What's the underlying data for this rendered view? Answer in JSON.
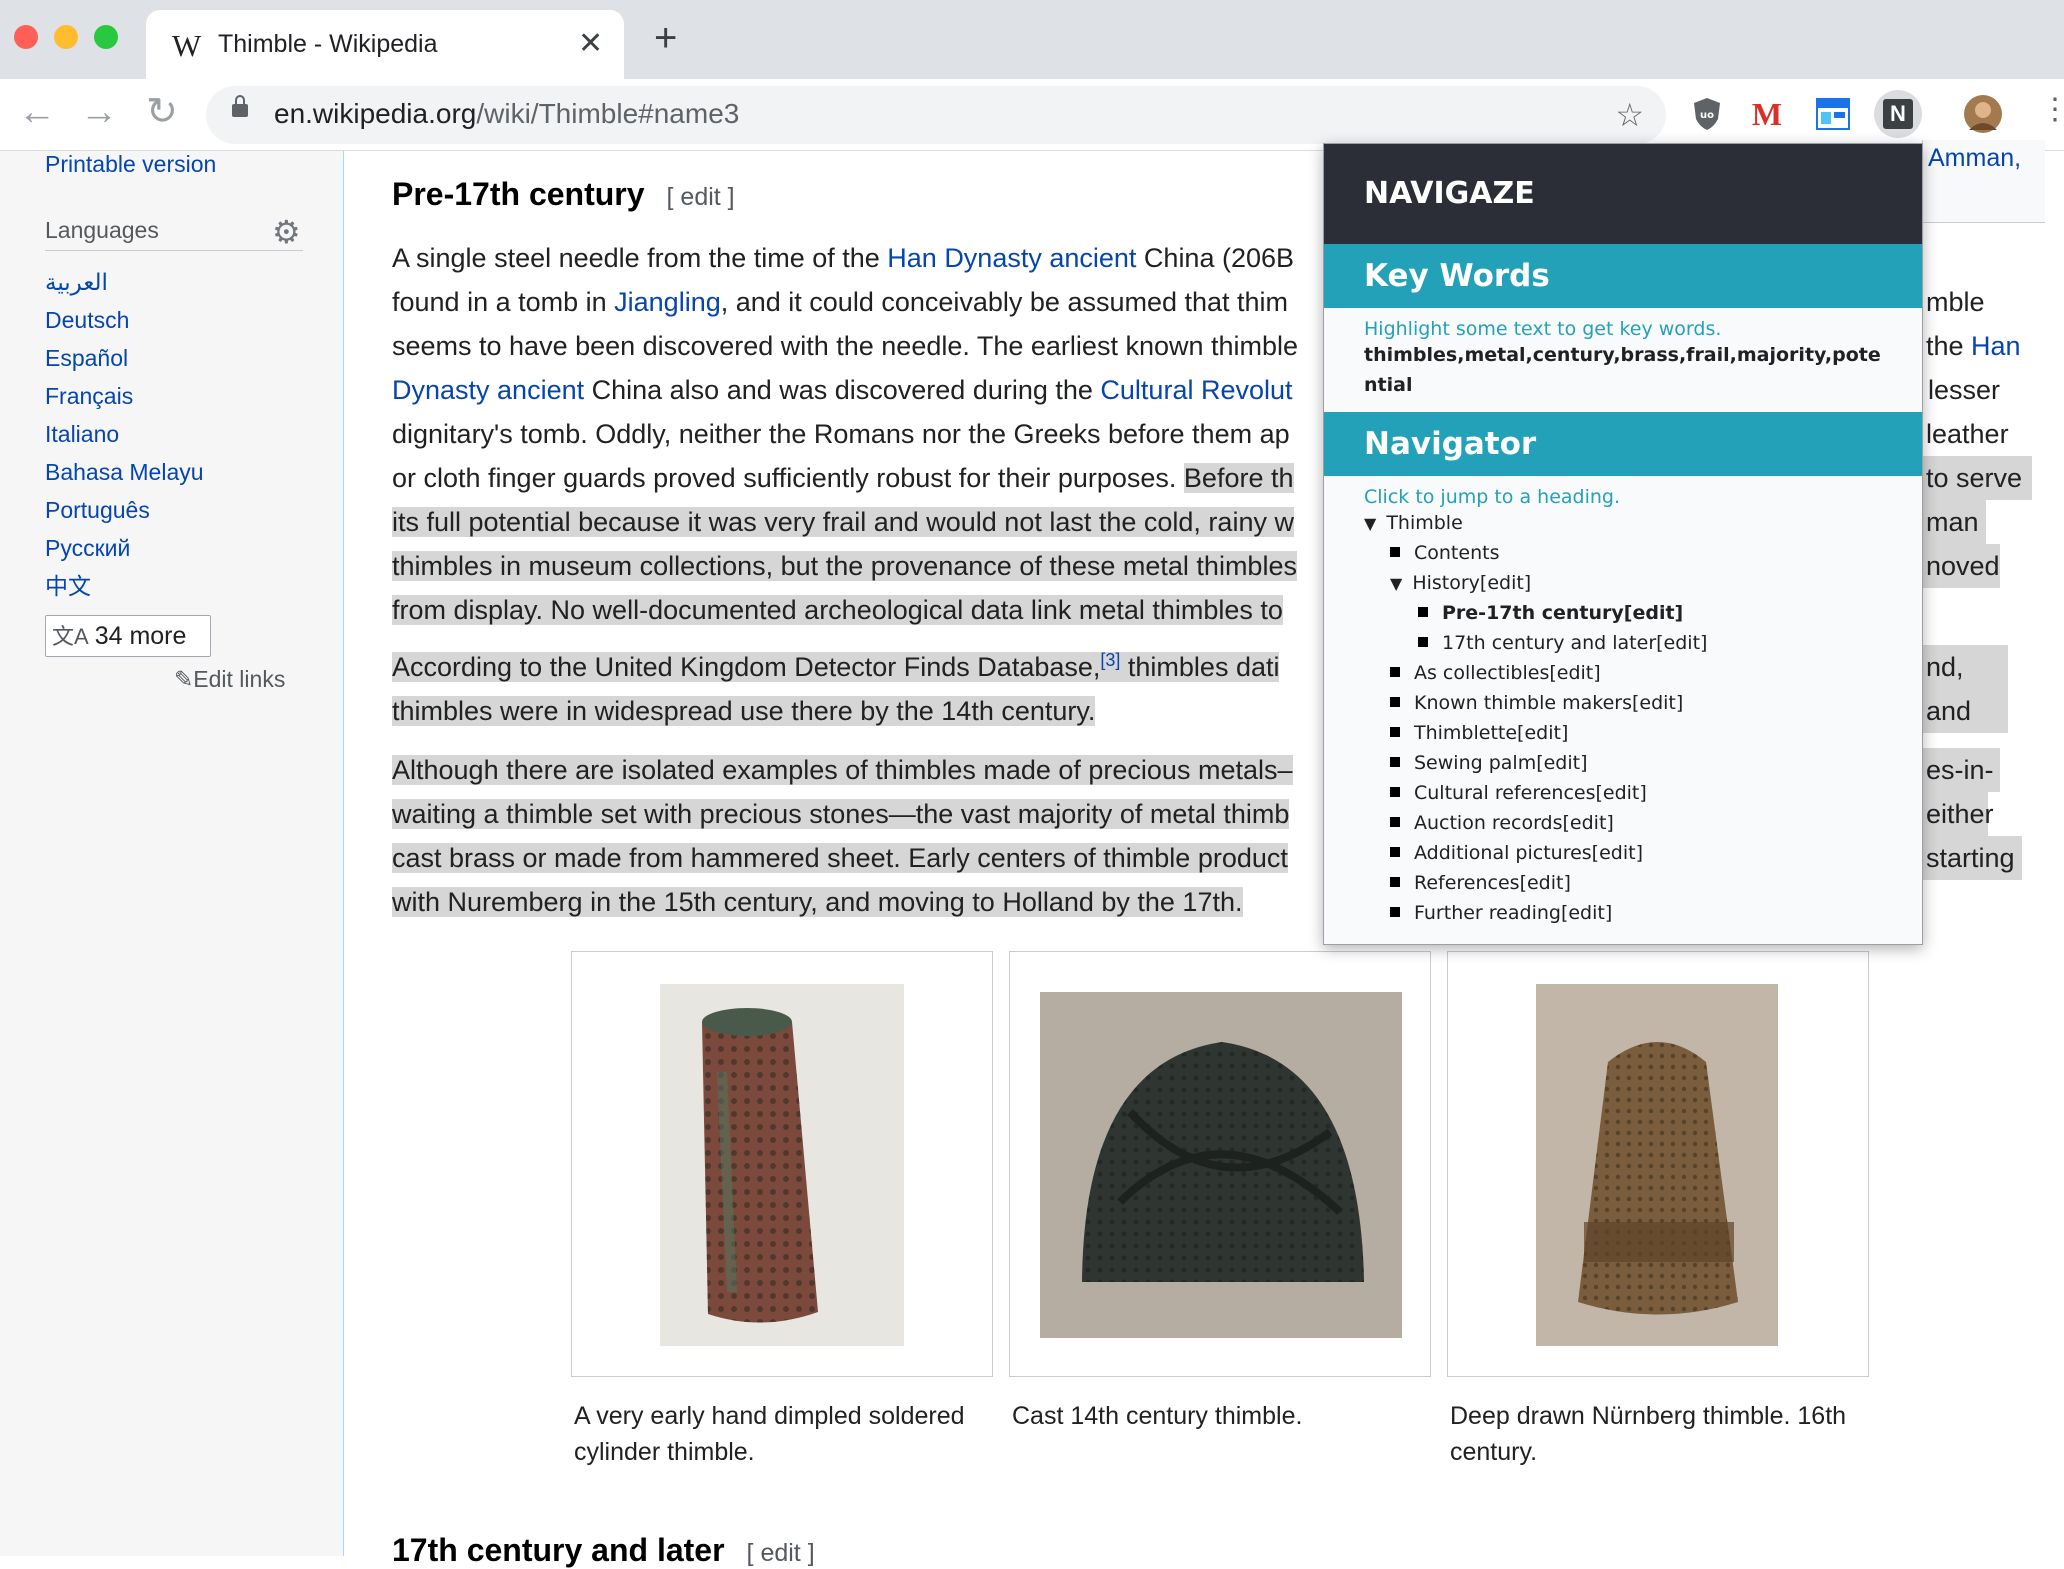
{
  "browser": {
    "tab_title": "Thimble - Wikipedia",
    "tab_icon": "W",
    "url_domain": "en.wikipedia.org",
    "url_path": "/wiki/Thimble#name3",
    "extensions": [
      "ublock-icon",
      "gmail-icon",
      "calendar-icon",
      "navigaze-icon",
      "profile-avatar"
    ],
    "ext_letters": {
      "gmail": "M",
      "navigaze": "N"
    }
  },
  "sidebar": {
    "printable": "Printable version",
    "languages_heading": "Languages",
    "languages": [
      "العربية",
      "Deutsch",
      "Español",
      "Français",
      "Italiano",
      "Bahasa Melayu",
      "Português",
      "Русский",
      "中文"
    ],
    "more_label": "34 more",
    "edit_links": "Edit links"
  },
  "article": {
    "heading1": "Pre-17th century",
    "edit_label": "[ edit ]",
    "p1": {
      "l1a": "A single steel needle from the time of the ",
      "l1link1": "Han Dynasty ancient",
      "l1b": " China (206B",
      "l2a": "found in a tomb in ",
      "l2link": "Jiangling",
      "l2b": ", and it could conceivably be assumed that thim",
      "l3": "seems to have been discovered with the needle. The earliest known thimble",
      "l4link": "Dynasty ancient",
      "l4a": " China also and was discovered during the ",
      "l4link2": "Cultural Revolut",
      "l5": "dignitary's tomb. Oddly, neither the Romans nor the Greeks before them ap",
      "l6a": "or cloth finger guards proved sufficiently robust for their purposes. ",
      "l6b": "Before th",
      "l7": "its full potential because it was very frail and would not last the cold, rainy w",
      "l8": "thimbles in museum collections, but the provenance of these metal thimbles",
      "l9": "from display. No well-documented archeological data link metal thimbles to"
    },
    "right_col": {
      "r0": "Amman,",
      "r1": "mble",
      "r2a": "the ",
      "r2link": "Han",
      "r3": "lesser",
      "r4": "leather",
      "r5": "to serve",
      "r6": "man",
      "r7": "noved",
      "r8": "nd, and",
      "r9": "es-in-",
      "r10": "either",
      "r11": "starting"
    },
    "p2": {
      "l1": "According to the United Kingdom Detector Finds Database,",
      "ref": "[3]",
      "l1b": " thimbles dati",
      "l2": "thimbles were in widespread use there by the 14th century."
    },
    "p3": {
      "l1": "Although there are isolated examples of thimbles made of precious metals–",
      "l2": "waiting a thimble set with precious stones—the vast majority of metal thimb",
      "l3": "cast brass or made from hammered sheet. Early centers of thimble product",
      "l4": "with Nuremberg in the 15th century, and moving to Holland by the 17th."
    },
    "figures": [
      {
        "caption": "A very early hand dimpled soldered cylinder thimble."
      },
      {
        "caption": "Cast 14th century thimble."
      },
      {
        "caption": "Deep drawn Nürnberg thimble. 16th century."
      }
    ],
    "heading2": "17th century and later",
    "edit_label2": "[ edit ]"
  },
  "navigaze": {
    "title": "NAVIGAZE",
    "keywords_heading": "Key Words",
    "keywords_hint": "Highlight some text to get key words.",
    "keywords": "thimbles,metal,century,brass,frail,majority,potential",
    "navigator_heading": "Navigator",
    "navigator_hint": "Click to jump to a heading.",
    "tree": {
      "root": "Thimble",
      "contents": "Contents",
      "history": "History[edit]",
      "pre17": "Pre-17th century[edit]",
      "later17": "17th century and later[edit]",
      "items": [
        "As collectibles[edit]",
        "Known thimble makers[edit]",
        "Thimblette[edit]",
        "Sewing palm[edit]",
        "Cultural references[edit]",
        "Auction records[edit]",
        "Additional pictures[edit]",
        "References[edit]",
        "Further reading[edit]"
      ]
    }
  }
}
